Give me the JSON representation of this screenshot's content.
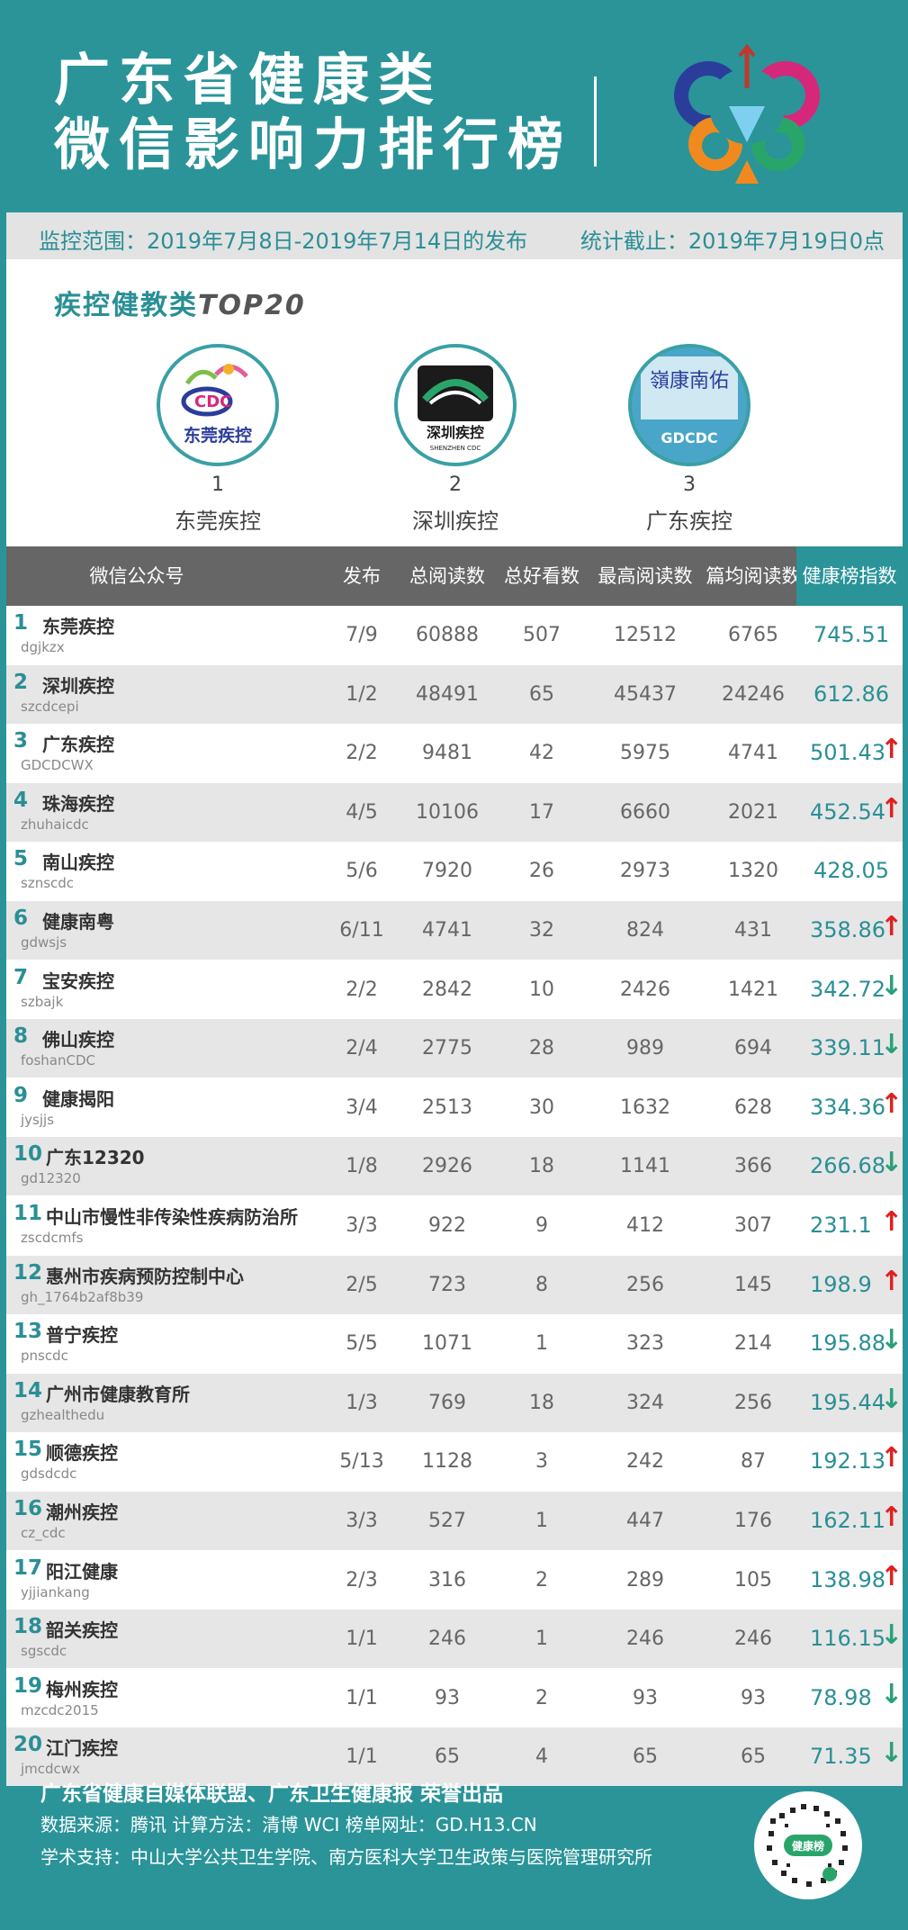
{
  "header": {
    "title_line1": "广东省健康类",
    "title_line2": "微信影响力排行榜"
  },
  "range": {
    "left": "监控范围：2019年7月8日-2019年7月14日的发布",
    "right": "统计截止：2019年7月19日0点"
  },
  "section": {
    "title": "疾控健教类",
    "top": "TOP20"
  },
  "winners": [
    {
      "rank": "1",
      "name": "东莞疾控",
      "logo_text": "东莞疾控",
      "logo_sub": "CDC"
    },
    {
      "rank": "2",
      "name": "深圳疾控",
      "logo_text": "深圳疾控",
      "logo_sub": "SHENZHEN CDC"
    },
    {
      "rank": "3",
      "name": "广东疾控",
      "logo_text": "嶺康南佑",
      "logo_sub": "GDCDC"
    }
  ],
  "table": {
    "headers": [
      "微信公众号",
      "发布",
      "总阅读数",
      "总好看数",
      "最高阅读数",
      "篇均阅读数",
      "健康榜指数"
    ],
    "rows": [
      {
        "rank": "1",
        "name": "东莞疾控",
        "account": "dgjkzx",
        "publish": "7/9",
        "total_reads": "60888",
        "total_likes": "507",
        "max_reads": "12512",
        "avg_reads": "6765",
        "index": "745.51",
        "trend": ""
      },
      {
        "rank": "2",
        "name": "深圳疾控",
        "account": "szcdcepi",
        "publish": "1/2",
        "total_reads": "48491",
        "total_likes": "65",
        "max_reads": "45437",
        "avg_reads": "24246",
        "index": "612.86",
        "trend": ""
      },
      {
        "rank": "3",
        "name": "广东疾控",
        "account": "GDCDCWX",
        "publish": "2/2",
        "total_reads": "9481",
        "total_likes": "42",
        "max_reads": "5975",
        "avg_reads": "4741",
        "index": "501.43",
        "trend": "up"
      },
      {
        "rank": "4",
        "name": "珠海疾控",
        "account": "zhuhaicdc",
        "publish": "4/5",
        "total_reads": "10106",
        "total_likes": "17",
        "max_reads": "6660",
        "avg_reads": "2021",
        "index": "452.54",
        "trend": "up"
      },
      {
        "rank": "5",
        "name": "南山疾控",
        "account": "sznscdc",
        "publish": "5/6",
        "total_reads": "7920",
        "total_likes": "26",
        "max_reads": "2973",
        "avg_reads": "1320",
        "index": "428.05",
        "trend": ""
      },
      {
        "rank": "6",
        "name": "健康南粤",
        "account": "gdwsjs",
        "publish": "6/11",
        "total_reads": "4741",
        "total_likes": "32",
        "max_reads": "824",
        "avg_reads": "431",
        "index": "358.86",
        "trend": "up"
      },
      {
        "rank": "7",
        "name": "宝安疾控",
        "account": "szbajk",
        "publish": "2/2",
        "total_reads": "2842",
        "total_likes": "10",
        "max_reads": "2426",
        "avg_reads": "1421",
        "index": "342.72",
        "trend": "down"
      },
      {
        "rank": "8",
        "name": "佛山疾控",
        "account": "foshanCDC",
        "publish": "2/4",
        "total_reads": "2775",
        "total_likes": "28",
        "max_reads": "989",
        "avg_reads": "694",
        "index": "339.11",
        "trend": "down"
      },
      {
        "rank": "9",
        "name": "健康揭阳",
        "account": "jysjjs",
        "publish": "3/4",
        "total_reads": "2513",
        "total_likes": "30",
        "max_reads": "1632",
        "avg_reads": "628",
        "index": "334.36",
        "trend": "up"
      },
      {
        "rank": "10",
        "name": "广东12320",
        "account": "gd12320",
        "publish": "1/8",
        "total_reads": "2926",
        "total_likes": "18",
        "max_reads": "1141",
        "avg_reads": "366",
        "index": "266.68",
        "trend": "down"
      },
      {
        "rank": "11",
        "name": "中山市慢性非传染性疾病防治所",
        "account": "zscdcmfs",
        "publish": "3/3",
        "total_reads": "922",
        "total_likes": "9",
        "max_reads": "412",
        "avg_reads": "307",
        "index": "231.1",
        "trend": "up"
      },
      {
        "rank": "12",
        "name": "惠州市疾病预防控制中心",
        "account": "gh_1764b2af8b39",
        "publish": "2/5",
        "total_reads": "723",
        "total_likes": "8",
        "max_reads": "256",
        "avg_reads": "145",
        "index": "198.9",
        "trend": "up"
      },
      {
        "rank": "13",
        "name": "普宁疾控",
        "account": "pnscdc",
        "publish": "5/5",
        "total_reads": "1071",
        "total_likes": "1",
        "max_reads": "323",
        "avg_reads": "214",
        "index": "195.88",
        "trend": "down"
      },
      {
        "rank": "14",
        "name": "广州市健康教育所",
        "account": "gzhealthedu",
        "publish": "1/3",
        "total_reads": "769",
        "total_likes": "18",
        "max_reads": "324",
        "avg_reads": "256",
        "index": "195.44",
        "trend": "down"
      },
      {
        "rank": "15",
        "name": "顺德疾控",
        "account": "gdsdcdc",
        "publish": "5/13",
        "total_reads": "1128",
        "total_likes": "3",
        "max_reads": "242",
        "avg_reads": "87",
        "index": "192.13",
        "trend": "up"
      },
      {
        "rank": "16",
        "name": "潮州疾控",
        "account": "cz_cdc",
        "publish": "3/3",
        "total_reads": "527",
        "total_likes": "1",
        "max_reads": "447",
        "avg_reads": "176",
        "index": "162.11",
        "trend": "up"
      },
      {
        "rank": "17",
        "name": "阳江健康",
        "account": "yjjiankang",
        "publish": "2/3",
        "total_reads": "316",
        "total_likes": "2",
        "max_reads": "289",
        "avg_reads": "105",
        "index": "138.98",
        "trend": "up"
      },
      {
        "rank": "18",
        "name": "韶关疾控",
        "account": "sgscdc",
        "publish": "1/1",
        "total_reads": "246",
        "total_likes": "1",
        "max_reads": "246",
        "avg_reads": "246",
        "index": "116.15",
        "trend": "down"
      },
      {
        "rank": "19",
        "name": "梅州疾控",
        "account": "mzcdc2015",
        "publish": "1/1",
        "total_reads": "93",
        "total_likes": "2",
        "max_reads": "93",
        "avg_reads": "93",
        "index": "78.98",
        "trend": "down"
      },
      {
        "rank": "20",
        "name": "江门疾控",
        "account": "jmcdcwx",
        "publish": "1/1",
        "total_reads": "65",
        "total_likes": "4",
        "max_reads": "65",
        "avg_reads": "65",
        "index": "71.35",
        "trend": "down"
      }
    ]
  },
  "footer": {
    "line1": "广东省健康自媒体联盟、广东卫生健康报 荣誉出品",
    "line2": "数据来源：腾讯   计算方法：清博 WCI   榜单网址：GD.H13.CN",
    "line3": "学术支持：中山大学公共卫生学院、南方医科大学卫生政策与医院管理研究所",
    "qr_label": "健康榜"
  },
  "colors": {
    "teal": "#2a9499",
    "up": "#e02020",
    "down": "#2aa07a"
  },
  "icons": {
    "trend_up": "↑",
    "trend_down": "↓"
  }
}
